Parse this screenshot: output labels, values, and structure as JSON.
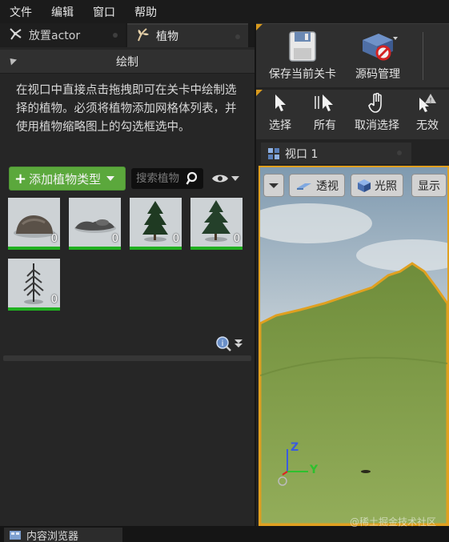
{
  "menu": [
    "文件",
    "编辑",
    "窗口",
    "帮助"
  ],
  "left_tabs": [
    {
      "label": "放置actor",
      "icon": "place-actor-icon",
      "active": false
    },
    {
      "label": "植物",
      "icon": "foliage-icon",
      "active": true
    }
  ],
  "paint_section": {
    "title": "绘制",
    "description": "在视口中直接点击拖拽即可在关卡中绘制选择的植物。必须将植物添加网格体列表，并使用植物缩略图上的勾选框选中。"
  },
  "add_foliage_button": "添加植物类型",
  "search": {
    "placeholder": "搜索植物"
  },
  "foliage_items": [
    {
      "kind": "rock",
      "count": "0"
    },
    {
      "kind": "rocks-flat",
      "count": "0"
    },
    {
      "kind": "pine-tree",
      "count": "0"
    },
    {
      "kind": "pine-tree-2",
      "count": "0"
    },
    {
      "kind": "dead-tree",
      "count": "0"
    }
  ],
  "toolbar_main": [
    {
      "label": "保存当前关卡",
      "icon": "save-icon"
    },
    {
      "label": "源码管理",
      "icon": "source-control-icon"
    }
  ],
  "toolbar_select": [
    {
      "label": "选择",
      "icon": "cursor-icon"
    },
    {
      "label": "所有",
      "icon": "select-all-icon"
    },
    {
      "label": "取消选择",
      "icon": "deselect-hand-icon"
    },
    {
      "label": "无效",
      "icon": "invalid-icon"
    }
  ],
  "viewport": {
    "tab_label": "视口 1",
    "buttons": [
      {
        "label": "透视",
        "icon": "perspective-icon"
      },
      {
        "label": "光照",
        "icon": "lit-cube-icon"
      },
      {
        "label": "显示",
        "icon": ""
      }
    ],
    "axis_z": "Z",
    "axis_y": "Y"
  },
  "bottom_tab": "内容浏览器",
  "watermark": "@稀土掘金技术社区",
  "colors": {
    "accent_orange": "#e0a020",
    "add_green": "#5ba83c",
    "thumb_underline": "#20b020"
  }
}
